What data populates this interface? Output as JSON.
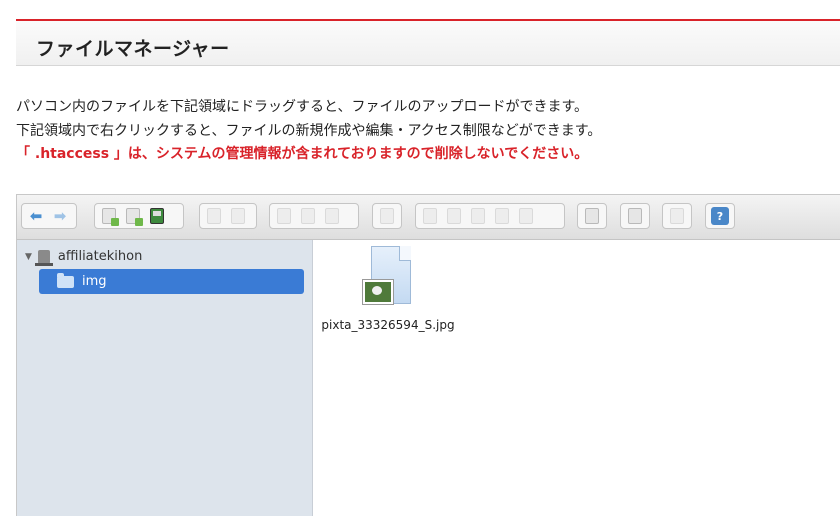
{
  "page": {
    "title": "ファイルマネージャー",
    "description_line1": "パソコン内のファイルを下記領域にドラッグすると、ファイルのアップロードができます。",
    "description_line2": "下記領域内で右クリックすると、ファイルの新規作成や編集・アクセス制限などができます。",
    "warning": "「 .htaccess 」は、システムの管理情報が含まれておりますので削除しないでください。",
    "accent_color": "#d9232a"
  },
  "toolbar": {
    "groups": [
      {
        "name": "navigation",
        "icons": [
          "back-arrow-icon",
          "forward-arrow-icon"
        ]
      },
      {
        "name": "file-ops",
        "icons": [
          "upload-icon",
          "new-file-icon",
          "save-icon"
        ]
      },
      {
        "name": "view",
        "icons": [
          "open-icon",
          "save-as-icon"
        ]
      },
      {
        "name": "clipboard",
        "icons": [
          "copy-icon",
          "cut-icon",
          "paste-icon"
        ]
      },
      {
        "name": "info",
        "icons": [
          "info-icon"
        ]
      },
      {
        "name": "edit",
        "icons": [
          "duplicate-icon",
          "select-icon",
          "extract-icon",
          "archive-icon",
          "resize-icon"
        ]
      },
      {
        "name": "display",
        "icons": [
          "view-icon"
        ]
      },
      {
        "name": "preview",
        "icons": [
          "preview-icon"
        ]
      },
      {
        "name": "permissions",
        "icons": [
          "lock-icon"
        ]
      },
      {
        "name": "help",
        "icons": [
          "help-icon"
        ],
        "help_glyph": "?"
      }
    ]
  },
  "tree": {
    "root_label": "affiliatekihon",
    "selected_folder": "img"
  },
  "files": [
    {
      "name": "pixta_33326594_S.jpg",
      "icon": "image-file-icon"
    }
  ]
}
